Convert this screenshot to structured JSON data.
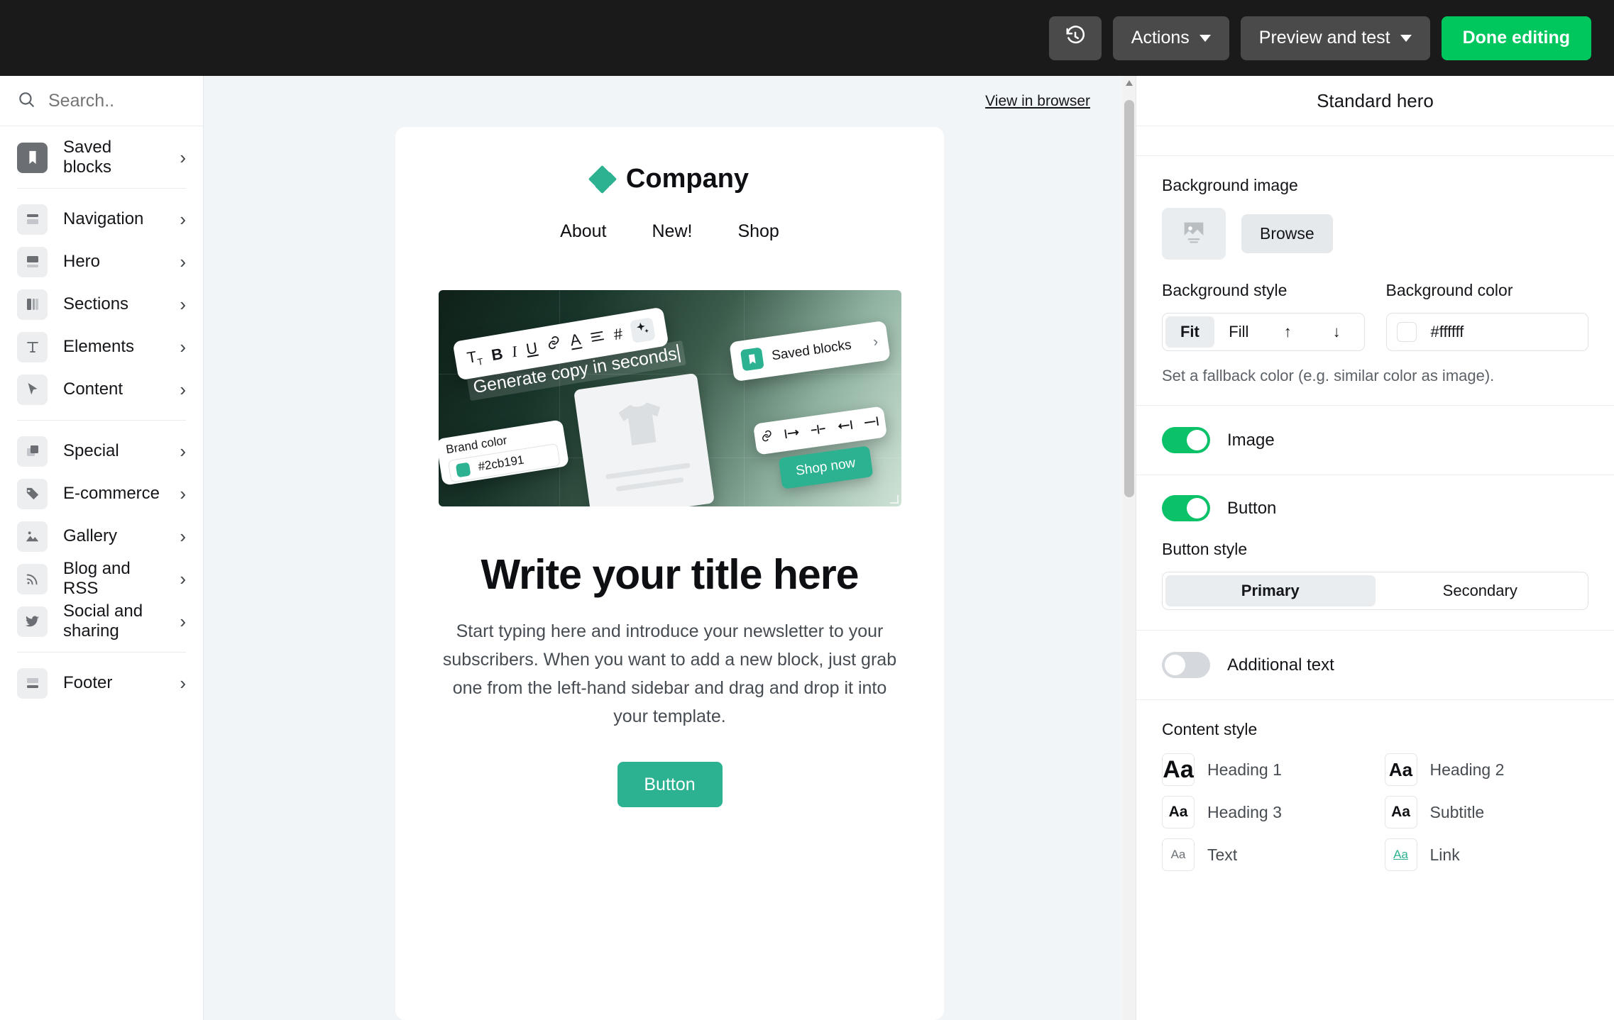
{
  "topbar": {
    "history_icon": "history-icon",
    "actions_label": "Actions",
    "preview_label": "Preview and test",
    "done_label": "Done editing"
  },
  "sidebar": {
    "search_placeholder": "Search..",
    "search_value": "",
    "search_icon": "search-icon",
    "items": [
      {
        "label": "Saved blocks",
        "icon": "bookmark-icon",
        "chevron": "›"
      },
      {
        "label": "Navigation",
        "icon": "navigation-block-icon",
        "chevron": "›"
      },
      {
        "label": "Hero",
        "icon": "hero-block-icon",
        "chevron": "›"
      },
      {
        "label": "Sections",
        "icon": "columns-icon",
        "chevron": "›"
      },
      {
        "label": "Elements",
        "icon": "text-t-icon",
        "chevron": "›"
      },
      {
        "label": "Content",
        "icon": "cursor-arrow-icon",
        "chevron": "›"
      },
      {
        "label": "Special",
        "icon": "layers-icon",
        "chevron": "›"
      },
      {
        "label": "E-commerce",
        "icon": "tag-icon",
        "chevron": "›"
      },
      {
        "label": "Gallery",
        "icon": "image-mountain-icon",
        "chevron": "›"
      },
      {
        "label": "Blog and RSS",
        "icon": "rss-icon",
        "chevron": "›"
      },
      {
        "label": "Social and sharing",
        "icon": "twitter-bird-icon",
        "chevron": "›"
      },
      {
        "label": "Footer",
        "icon": "footer-block-icon",
        "chevron": "›"
      }
    ]
  },
  "canvas": {
    "view_in_browser": "View in browser",
    "brand_name": "Company",
    "nav": [
      "About",
      "New!",
      "Shop"
    ],
    "hero_image": {
      "toolbar_icons": [
        "Tᴛ",
        "B",
        "I",
        "U",
        "🔗",
        "A",
        "☰",
        "#",
        "✦"
      ],
      "caption": "Generate copy in seconds",
      "saved_blocks_label": "Saved blocks",
      "saved_blocks_chevron": "›",
      "brand_color_label": "Brand color",
      "brand_color_hex": "#2cb191",
      "shop_now_label": "Shop now",
      "align_icons": [
        "🔗",
        "|←",
        "↔",
        "→|",
        "—|"
      ]
    },
    "title": "Write your title here",
    "body": "Start typing here and introduce your newsletter to your subscribers. When you want to add a new block, just grab one from the left-hand sidebar and drag and drop it into your template.",
    "button_label": "Button"
  },
  "panel": {
    "title": "Standard hero",
    "background_image_label": "Background image",
    "browse_label": "Browse",
    "image_placeholder_icon": "image-placeholder-icon",
    "background_style_label": "Background style",
    "background_style_options": [
      "Fit",
      "Fill",
      "↑",
      "↓"
    ],
    "background_style_selected": "Fit",
    "background_color_label": "Background color",
    "background_color_value": "#ffffff",
    "fallback_hint": "Set a fallback color (e.g. similar color as image).",
    "toggles": [
      {
        "label": "Image",
        "on": true
      },
      {
        "label": "Button",
        "on": true
      },
      {
        "label": "Additional text",
        "on": false
      }
    ],
    "button_style_label": "Button style",
    "button_style_options": [
      "Primary",
      "Secondary"
    ],
    "button_style_selected": "Primary",
    "content_style_label": "Content style",
    "content_styles": [
      {
        "name": "Heading 1",
        "sample": "Aa"
      },
      {
        "name": "Heading 2",
        "sample": "Aa"
      },
      {
        "name": "Heading 3",
        "sample": "Aa"
      },
      {
        "name": "Subtitle",
        "sample": "Aa"
      },
      {
        "name": "Text",
        "sample": "Aa"
      },
      {
        "name": "Link",
        "sample": "Aa"
      }
    ]
  },
  "colors": {
    "accent": "#2cb191",
    "toggle_on": "#0bc268",
    "done_button": "#00c65e",
    "topbar_bg": "#1a1a1a"
  }
}
